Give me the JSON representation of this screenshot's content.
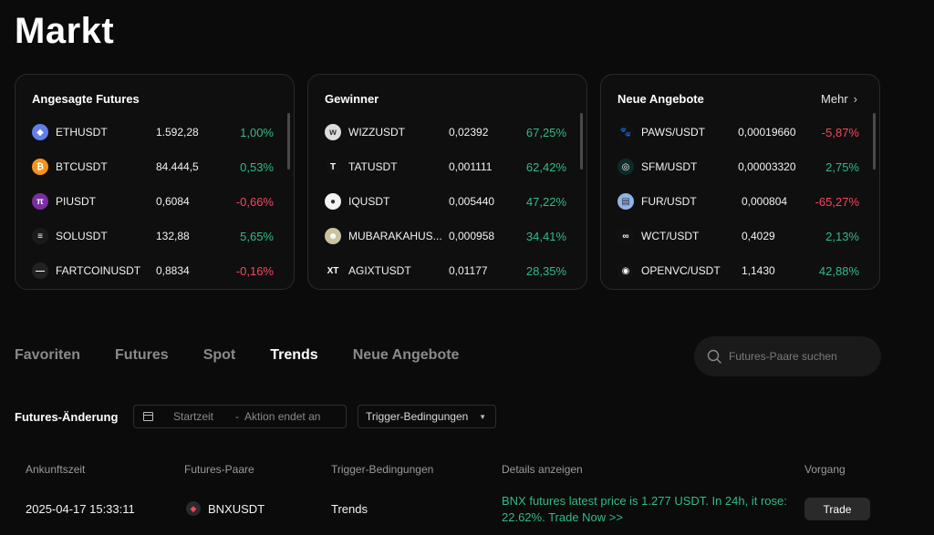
{
  "page": {
    "title": "Markt"
  },
  "cards": [
    {
      "title": "Angesagte Futures",
      "more": "",
      "rows": [
        {
          "symbol": "ETHUSDT",
          "price": "1.592,28",
          "change": "1,00%",
          "dir": "up",
          "icon": "eth-icon",
          "color": "#627eea",
          "glyph": "◆"
        },
        {
          "symbol": "BTCUSDT",
          "price": "84.444,5",
          "change": "0,53%",
          "dir": "up",
          "icon": "btc-icon",
          "color": "#f7931a",
          "glyph": "₿"
        },
        {
          "symbol": "PIUSDT",
          "price": "0,6084",
          "change": "-0,66%",
          "dir": "down",
          "icon": "pi-icon",
          "color": "#7b2ea3",
          "glyph": "π"
        },
        {
          "symbol": "SOLUSDT",
          "price": "132,88",
          "change": "5,65%",
          "dir": "up",
          "icon": "sol-icon",
          "color": "#1a1a1a",
          "glyph": "≡"
        },
        {
          "symbol": "FARTCOINUSDT",
          "price": "0,8834",
          "change": "-0,16%",
          "dir": "down",
          "icon": "fartcoin-icon",
          "color": "#222222",
          "glyph": "—"
        }
      ]
    },
    {
      "title": "Gewinner",
      "more": "",
      "rows": [
        {
          "symbol": "WIZZUSDT",
          "price": "0,02392",
          "change": "67,25%",
          "dir": "up",
          "icon": "wizz-icon",
          "color": "#dddddd",
          "glyph": "w"
        },
        {
          "symbol": "TATUSDT",
          "price": "0,001111",
          "change": "62,42%",
          "dir": "up",
          "icon": "tat-icon",
          "color": "#111111",
          "glyph": "T"
        },
        {
          "symbol": "IQUSDT",
          "price": "0,005440",
          "change": "47,22%",
          "dir": "up",
          "icon": "iq-icon",
          "color": "#f3f3f3",
          "glyph": "●"
        },
        {
          "symbol": "MUBARAKAHUS...",
          "price": "0,000958",
          "change": "34,41%",
          "dir": "up",
          "icon": "mubarak-icon",
          "color": "#c9c3a0",
          "glyph": "☻"
        },
        {
          "symbol": "AGIXTUSDT",
          "price": "0,01177",
          "change": "28,35%",
          "dir": "up",
          "icon": "agix-icon",
          "color": "#111111",
          "glyph": "XT"
        }
      ]
    },
    {
      "title": "Neue Angebote",
      "more": "Mehr",
      "rows": [
        {
          "symbol": "PAWS/USDT",
          "price": "0,00019660",
          "change": "-5,87%",
          "dir": "down",
          "icon": "paws-icon",
          "color": "#111111",
          "glyph": "🐾"
        },
        {
          "symbol": "SFM/USDT",
          "price": "0,00003320",
          "change": "2,75%",
          "dir": "up",
          "icon": "sfm-icon",
          "color": "#0f2a2a",
          "glyph": "◎"
        },
        {
          "symbol": "FUR/USDT",
          "price": "0,000804",
          "change": "-65,27%",
          "dir": "down",
          "icon": "fur-icon",
          "color": "#8fb3e8",
          "glyph": "▤"
        },
        {
          "symbol": "WCT/USDT",
          "price": "0,4029",
          "change": "2,13%",
          "dir": "up",
          "icon": "wct-icon",
          "color": "#111111",
          "glyph": "∞"
        },
        {
          "symbol": "OPENVC/USDT",
          "price": "1,1430",
          "change": "42,88%",
          "dir": "up",
          "icon": "openvc-icon",
          "color": "#111111",
          "glyph": "◉"
        }
      ]
    }
  ],
  "tabs": [
    "Favoriten",
    "Futures",
    "Spot",
    "Trends",
    "Neue Angebote"
  ],
  "active_tab": "Trends",
  "search": {
    "placeholder": "Futures-Paare suchen"
  },
  "filters": {
    "label": "Futures-Änderung",
    "start_placeholder": "Startzeit",
    "end_placeholder": "Aktion endet an",
    "trigger_select": "Trigger-Bedingungen"
  },
  "table": {
    "headers": [
      "Ankunftszeit",
      "Futures-Paare",
      "Trigger-Bedingungen",
      "Details anzeigen",
      "Vorgang"
    ],
    "rows": [
      {
        "time": "2025-04-17 15:33:11",
        "pair": "BNXUSDT",
        "trigger": "Trends",
        "details": "BNX futures latest price is 1.277 USDT. In 24h, it rose: 22.62%. Trade Now >>",
        "action": "Trade"
      }
    ]
  },
  "colors": {
    "up": "#2ebd85",
    "down": "#f6465d",
    "background": "#0b0b0b"
  }
}
